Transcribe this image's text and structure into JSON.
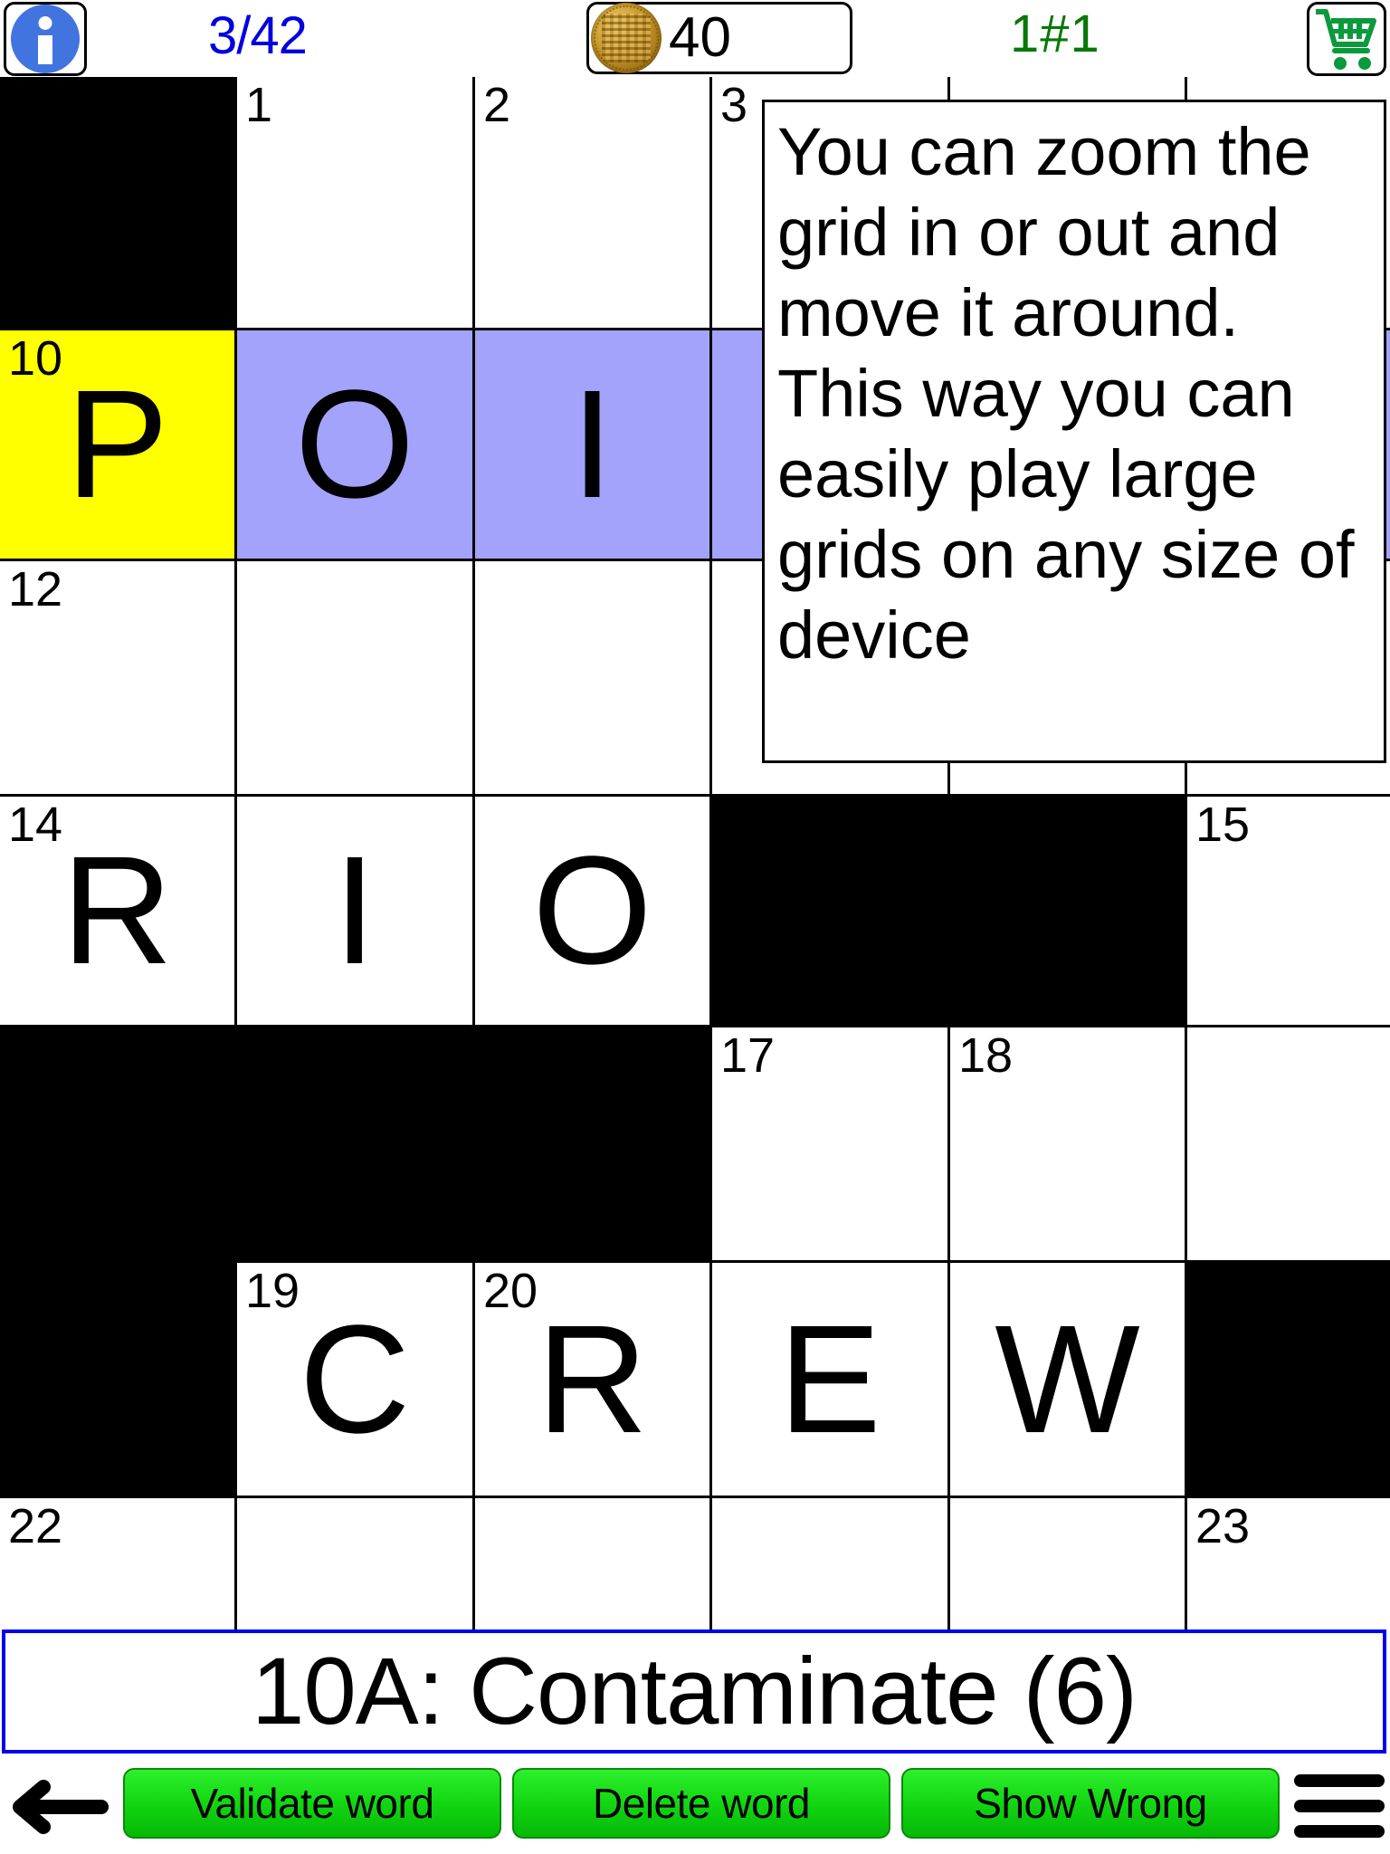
{
  "topbar": {
    "info_icon": "info-icon",
    "progress": "3/42",
    "coin_icon": "gold-coin-icon",
    "coin_count": "40",
    "level": "1#1",
    "cart_icon": "shopping-cart-icon"
  },
  "tooltip": {
    "text": "You can zoom the grid in or out and move it around. This way you can easily play large grids on any size of device"
  },
  "grid": {
    "columns": 6,
    "rows": 7,
    "colors": {
      "block": "#000000",
      "empty": "#ffffff",
      "highlight": "#a3a3fb",
      "cursor": "#ffff00",
      "clue_border": "#0000ee"
    },
    "cells": [
      [
        {
          "type": "block"
        },
        {
          "type": "open",
          "num": "1",
          "letter": ""
        },
        {
          "type": "open",
          "num": "2",
          "letter": ""
        },
        {
          "type": "open",
          "num": "3",
          "letter": ""
        },
        {
          "type": "open",
          "num": "",
          "letter": ""
        },
        {
          "type": "open",
          "num": "",
          "letter": ""
        }
      ],
      [
        {
          "type": "cursor",
          "num": "10",
          "letter": "P"
        },
        {
          "type": "highlight",
          "num": "",
          "letter": "O"
        },
        {
          "type": "highlight",
          "num": "",
          "letter": "I"
        },
        {
          "type": "highlight",
          "num": "",
          "letter": ""
        },
        {
          "type": "highlight",
          "num": "",
          "letter": ""
        },
        {
          "type": "highlight",
          "num": "",
          "letter": ""
        }
      ],
      [
        {
          "type": "open",
          "num": "12",
          "letter": ""
        },
        {
          "type": "open",
          "num": "",
          "letter": ""
        },
        {
          "type": "open",
          "num": "",
          "letter": ""
        },
        {
          "type": "open",
          "num": "",
          "letter": ""
        },
        {
          "type": "open",
          "num": "",
          "letter": ""
        },
        {
          "type": "open",
          "num": "",
          "letter": ""
        }
      ],
      [
        {
          "type": "open",
          "num": "14",
          "letter": "R"
        },
        {
          "type": "open",
          "num": "",
          "letter": "I"
        },
        {
          "type": "open",
          "num": "",
          "letter": "O"
        },
        {
          "type": "block"
        },
        {
          "type": "block"
        },
        {
          "type": "open",
          "num": "15",
          "letter": ""
        }
      ],
      [
        {
          "type": "block"
        },
        {
          "type": "block"
        },
        {
          "type": "block"
        },
        {
          "type": "open",
          "num": "17",
          "letter": ""
        },
        {
          "type": "open",
          "num": "18",
          "letter": ""
        },
        {
          "type": "open",
          "num": "",
          "letter": ""
        }
      ],
      [
        {
          "type": "block"
        },
        {
          "type": "open",
          "num": "19",
          "letter": "C"
        },
        {
          "type": "open",
          "num": "20",
          "letter": "R"
        },
        {
          "type": "open",
          "num": "",
          "letter": "E"
        },
        {
          "type": "open",
          "num": "",
          "letter": "W"
        },
        {
          "type": "block"
        }
      ],
      [
        {
          "type": "open",
          "num": "22",
          "letter": ""
        },
        {
          "type": "open",
          "num": "",
          "letter": ""
        },
        {
          "type": "open",
          "num": "",
          "letter": ""
        },
        {
          "type": "open",
          "num": "",
          "letter": ""
        },
        {
          "type": "open",
          "num": "",
          "letter": ""
        },
        {
          "type": "open",
          "num": "23",
          "letter": ""
        }
      ]
    ]
  },
  "clue": {
    "text": "10A: Contaminate (6)"
  },
  "bottombar": {
    "back_icon": "back-arrow-icon",
    "validate_label": "Validate word",
    "delete_label": "Delete word",
    "show_wrong_label": "Show Wrong",
    "menu_icon": "hamburger-menu-icon"
  }
}
